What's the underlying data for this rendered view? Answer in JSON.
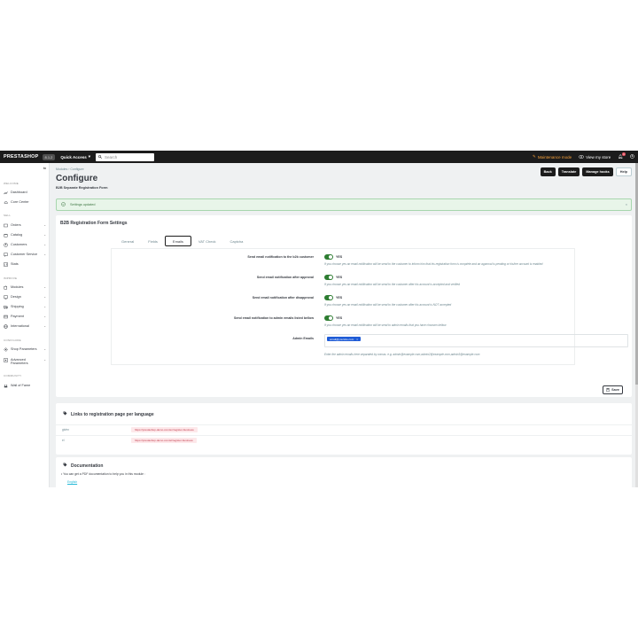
{
  "topbar": {
    "brand": "PRESTASHOP",
    "version": "8.1.2",
    "quick_access": "Quick Access",
    "search_placeholder": "Search",
    "maintenance": "Maintenance mode",
    "view_store": "View my store",
    "notif_count": "1"
  },
  "sidebar": {
    "sections": {
      "welcome": "WELCOME",
      "sell": "SELL",
      "improve": "IMPROVE",
      "configure": "CONFIGURE",
      "community": "COMMUNITY"
    },
    "items": [
      {
        "label": "Dashboard"
      },
      {
        "label": "Core Center"
      },
      {
        "label": "Orders"
      },
      {
        "label": "Catalog"
      },
      {
        "label": "Customers"
      },
      {
        "label": "Customer Service"
      },
      {
        "label": "Stats"
      },
      {
        "label": "Modules"
      },
      {
        "label": "Design"
      },
      {
        "label": "Shipping"
      },
      {
        "label": "Payment"
      },
      {
        "label": "International"
      },
      {
        "label": "Shop Parameters"
      },
      {
        "label": "Advanced Parameters"
      },
      {
        "label": "Wall of Fame"
      }
    ]
  },
  "header": {
    "breadcrumb_parent": "Modules",
    "breadcrumb_current": "Configure",
    "title": "Configure",
    "subtitle": "B2B Separate Registration Form",
    "buttons": {
      "back": "Back",
      "translate": "Translate",
      "manage_hooks": "Manage hooks",
      "help": "Help"
    }
  },
  "alert": {
    "text": "Settings updated"
  },
  "settings_card": {
    "title": "B2B Registration Form Settings",
    "tabs": [
      "General",
      "Fields",
      "Emails",
      "VAT Check",
      "Captcha"
    ],
    "active_tab": "Emails",
    "rows": [
      {
        "label": "Send email notification to the b2b customer",
        "value": "YES",
        "help": "If you choose yes an email notification will be send to the customer to inform him that his registration form is complete and an approval is pending or his/her account is enabled"
      },
      {
        "label": "Send email notification after approval",
        "value": "YES",
        "help": "If you choose yes an email notification will be send to the customer after his account is accepted and verified"
      },
      {
        "label": "Send email notification after disapproval",
        "value": "YES",
        "help": "If you choose yes an email notification will be send to the customer after his account is NOT accepted"
      },
      {
        "label": "Send email notification to admin emails listed bellow",
        "value": "YES",
        "help": "If you choose yes an email notification will be send to admin emails that you have choosen bellow"
      }
    ],
    "admin_emails_label": "Admin Emails",
    "admin_email_tag": "email@yoursite.com",
    "admin_emails_help": "Enter the admin emails here separated by comas. e.g. admin@example.com,admin2@example.com,admin3@example.com"
  },
  "save_label": "Save",
  "links_card": {
    "title": "Links to registration page per language",
    "rows": [
      {
        "lang": "gb/en",
        "url": "https://prestashop-demo.com/en/register-business"
      },
      {
        "lang": "el",
        "url": "https://prestashop-demo.com/el/register-business"
      }
    ]
  },
  "docs_card": {
    "title": "Documentation",
    "text": "• You can get a PDF documentation to help you in this module :",
    "link": "English"
  },
  "colors": {
    "accent": "#25b9d7",
    "toggle_on": "#2e7d32",
    "success_bg": "#e8f5e9",
    "link_bg": "#fde8ea"
  }
}
